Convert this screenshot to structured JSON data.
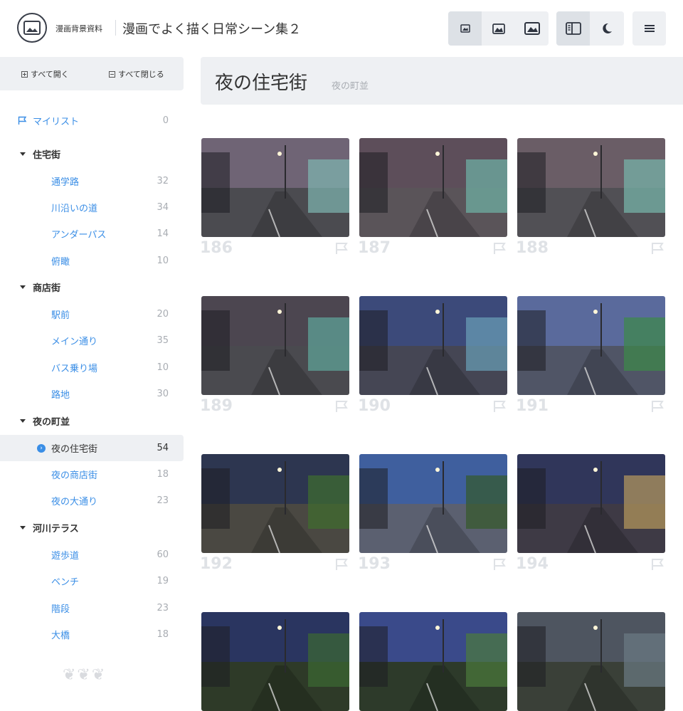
{
  "header": {
    "brand": "漫画背景資料",
    "title": "漫画でよく描く日常シーン集２",
    "view_buttons": [
      "small-image-icon",
      "medium-image-icon",
      "large-image-icon"
    ],
    "toggle_buttons": [
      "sidebar-icon",
      "moon-icon"
    ],
    "menu_icon": "hamburger-menu-icon"
  },
  "sidebar": {
    "expand_all": "すべて開く",
    "collapse_all": "すべて閉じる",
    "mylist": {
      "label": "マイリスト",
      "count": "0"
    },
    "categories": [
      {
        "label": "住宅街",
        "items": [
          {
            "label": "通学路",
            "count": "32"
          },
          {
            "label": "川沿いの道",
            "count": "34"
          },
          {
            "label": "アンダーパス",
            "count": "14"
          },
          {
            "label": "俯瞰",
            "count": "10"
          }
        ]
      },
      {
        "label": "商店街",
        "items": [
          {
            "label": "駅前",
            "count": "20"
          },
          {
            "label": "メイン通り",
            "count": "35"
          },
          {
            "label": "バス乗り場",
            "count": "10"
          },
          {
            "label": "路地",
            "count": "30"
          }
        ]
      },
      {
        "label": "夜の町並",
        "items": [
          {
            "label": "夜の住宅街",
            "count": "54",
            "active": true
          },
          {
            "label": "夜の商店街",
            "count": "18"
          },
          {
            "label": "夜の大通り",
            "count": "23"
          }
        ]
      },
      {
        "label": "河川テラス",
        "items": [
          {
            "label": "遊歩道",
            "count": "60"
          },
          {
            "label": "ベンチ",
            "count": "19"
          },
          {
            "label": "階段",
            "count": "23"
          },
          {
            "label": "大橋",
            "count": "18"
          }
        ]
      }
    ]
  },
  "main": {
    "title": "夜の住宅街",
    "subtitle": "夜の町並",
    "cards": [
      {
        "number": "186",
        "sky": "#6f6475",
        "ground": "#4b4b50",
        "accent": "#7fb7b0"
      },
      {
        "number": "187",
        "sky": "#5d4e5a",
        "ground": "#5a5459",
        "accent": "#6fb3a6"
      },
      {
        "number": "188",
        "sky": "#6a5d66",
        "ground": "#515055",
        "accent": "#77b8ad"
      },
      {
        "number": "189",
        "sky": "#4c4650",
        "ground": "#4a4a4f",
        "accent": "#5fa79b"
      },
      {
        "number": "190",
        "sky": "#3c4a7a",
        "ground": "#454654",
        "accent": "#6aa0b8"
      },
      {
        "number": "191",
        "sky": "#5a6a9c",
        "ground": "#505566",
        "accent": "#3c8a48"
      },
      {
        "number": "192",
        "sky": "#2d3650",
        "ground": "#4a4842",
        "accent": "#3f6e2e"
      },
      {
        "number": "193",
        "sky": "#3f5f9e",
        "ground": "#5b6070",
        "accent": "#355a2a"
      },
      {
        "number": "194",
        "sky": "#30365a",
        "ground": "#3e3a45",
        "accent": "#b89a5c"
      },
      {
        "number": "",
        "sky": "#2a3560",
        "ground": "#2e3a28",
        "accent": "#3c6a32"
      },
      {
        "number": "",
        "sky": "#3a4a8a",
        "ground": "#2d3a2a",
        "accent": "#4b7a3c"
      },
      {
        "number": "",
        "sky": "#4e5560",
        "ground": "#3a4038",
        "accent": "#6b7a84"
      }
    ]
  },
  "colors": {
    "accent": "#3a8ee6",
    "panel": "#eef0f3",
    "muted": "#a9adb3"
  }
}
